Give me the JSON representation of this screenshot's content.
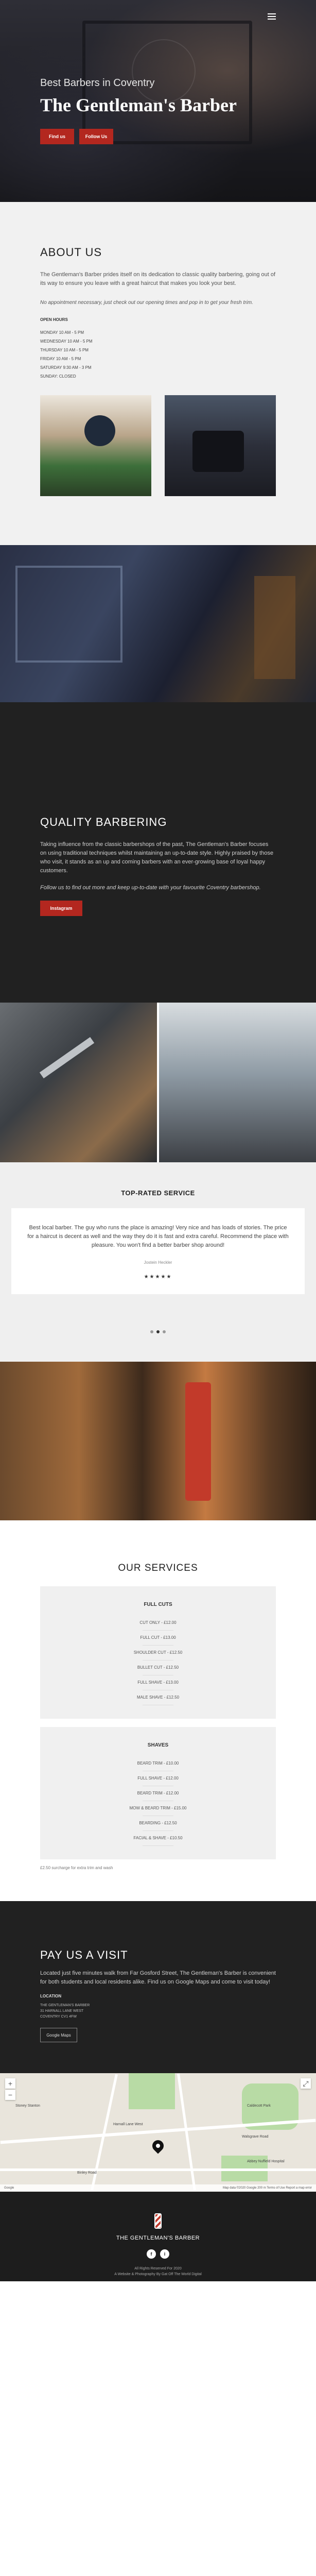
{
  "hero": {
    "subtitle": "Best Barbers in Coventry",
    "title": "The Gentleman's Barber",
    "find_us": "Find us",
    "follow_us": "Follow Us",
    "menu_icon": "hamburger-menu-icon"
  },
  "about": {
    "heading": "ABOUT US",
    "body": "The Gentleman's Barber prides itself on its dedication to classic quality barbering, going out of its way to ensure you leave with a great haircut that makes you look your best.",
    "note": "No appointment necessary, just check out our opening times and pop in to get your fresh trim.",
    "hours_title": "OPEN HOURS",
    "hours": [
      "MONDAY 10 AM - 5 PM",
      "WEDNESDAY 10 AM - 5 PM",
      "THURSDAY 10 AM - 5 PM",
      "FRIDAY 10 AM - 5 PM",
      "SATURDAY 9:30 AM - 3 PM",
      "SUNDAY: CLOSED"
    ]
  },
  "quality": {
    "heading": "QUALITY BARBERING",
    "body": "Taking influence from the classic barbershops of the past, The Gentleman's Barber focuses on using traditional techniques whilst maintaining an up-to-date style. Highly praised by those who visit, it stands as an up and coming barbers with an ever-growing base of loyal happy customers.",
    "cta_text": "Follow us to find out more and keep up-to-date with your favourite Coventry barbershop.",
    "button": "Instagram"
  },
  "reviews": {
    "heading": "TOP-RATED SERVICE",
    "text": "Best local barber. The guy who runs the place is amazing! Very nice and has loads of stories. The price for a haircut is decent as well and the way they do it is fast and extra careful. Recommend the place with pleasure. You won't find a better barber shop around!",
    "author": "Jostein Heckler",
    "stars": "★★★★★"
  },
  "services": {
    "heading": "OUR SERVICES",
    "groups": [
      {
        "title": "FULL CUTS",
        "items": [
          "CUT ONLY - £12.00",
          "FULL CUT - £13.00",
          "SHOULDER CUT - £12.50",
          "BULLET CUT - £12.50",
          "FULL SHAVE - £13.00",
          "MALE SHAVE - £12.50"
        ]
      },
      {
        "title": "SHAVES",
        "items": [
          "BEARD TRIM - £10.00",
          "FULL SHAVE - £12.00",
          "BEARD TRIM - £12.00",
          "MOW & BEARD TRIM - £15.00",
          "BEARDING - £12.50",
          "FACIAL & SHAVE - £10.50"
        ]
      }
    ],
    "note": "£2.50 surcharge for extra trim and wash"
  },
  "pay": {
    "heading": "PAY US A VISIT",
    "body": "Located just five minutes walk from Far Gosford Street, The Gentleman's Barber is convenient for both students and local residents alike. Find us on Google Maps and come to visit today!",
    "location_title": "LOCATION",
    "address": [
      "THE GENTLEMAN'S BARBER",
      "31 HARNALL LANE WEST",
      "COVENTRY CV1 4FW"
    ],
    "button": "Google Maps"
  },
  "map": {
    "labels": [
      "Harnall Lane West",
      "Walsgrave Road",
      "Abbey Nuffield Hospital",
      "Caldecott Park",
      "Binley Road",
      "Stoney Stanton"
    ],
    "footer_left": "Google",
    "footer_right": "Map data ©2020 Google   200 m   Terms of Use   Report a map error"
  },
  "footer": {
    "brand": "THE GENTLEMAN'S BARBER",
    "social": [
      "f",
      "i"
    ],
    "copy1": "All Rights Reserved For 2020",
    "copy2": "A Website & Photography By Gat Off The World Digital"
  }
}
